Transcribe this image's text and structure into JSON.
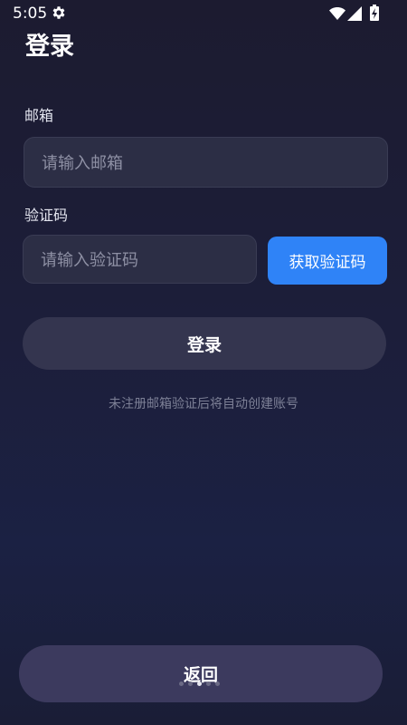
{
  "status_bar": {
    "time": "5:05",
    "icons": [
      "settings-icon",
      "wifi-icon",
      "signal-icon",
      "battery-icon"
    ]
  },
  "page": {
    "title": "登录"
  },
  "email": {
    "label": "邮箱",
    "placeholder": "请输入邮箱"
  },
  "code": {
    "label": "验证码",
    "placeholder": "请输入验证码",
    "button_label": "获取验证码"
  },
  "login_button_label": "登录",
  "hint": "未注册邮箱验证后将自动创建账号",
  "back_button_label": "返回",
  "colors": {
    "primary": "#2f83f7",
    "background": "#1c1e3a",
    "input_bg": "#2c2e45",
    "button_bg": "#34354f"
  }
}
